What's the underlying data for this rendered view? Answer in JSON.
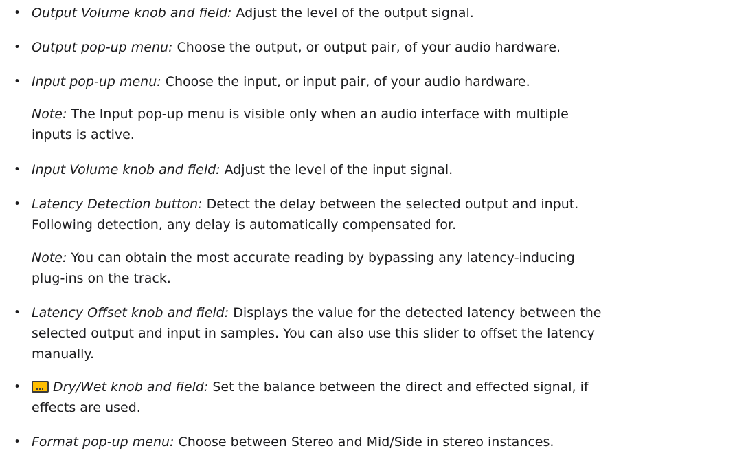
{
  "items": [
    {
      "term": "Output Volume knob and field:",
      "desc": " Adjust the level of the output signal."
    },
    {
      "term": "Output pop-up menu:",
      "desc": " Choose the output, or output pair, of your audio hardware."
    },
    {
      "term": "Input pop-up menu:",
      "desc": " Choose the input, or input pair, of your audio hardware."
    },
    {
      "note_label": "Note:",
      "note_line1": " The Input pop-up menu is visible only when an audio interface with multiple",
      "note_line2": "inputs is active."
    },
    {
      "term": "Input Volume knob and field:",
      "desc": " Adjust the level of the input signal."
    },
    {
      "term": "Latency Detection button:",
      "desc": " Detect the delay between the selected output and input.",
      "desc_line2": "Following detection, any delay is automatically compensated for."
    },
    {
      "note_label": "Note:",
      "note_line1": " You can obtain the most accurate reading by bypassing any latency-inducing",
      "note_line2": "plug-ins on the track."
    },
    {
      "term": "Latency Offset knob and field:",
      "desc": " Displays the value for the detected latency between the",
      "desc_line2": "selected output and input in samples. You can also use this slider to offset the latency",
      "desc_line3": "manually."
    },
    {
      "icon": "dry-wet-icon",
      "term": "Dry/Wet knob and field:",
      "desc": " Set the balance between the direct and effected signal, if",
      "desc_line2": "effects are used."
    },
    {
      "term": "Format pop-up menu:",
      "desc": " Choose between Stereo and Mid/Side in stereo instances."
    }
  ],
  "bullet": "•",
  "colors": {
    "icon_fill": "#ffbe00",
    "icon_border": "#3a3a3a",
    "text": "#1d1d1f"
  }
}
